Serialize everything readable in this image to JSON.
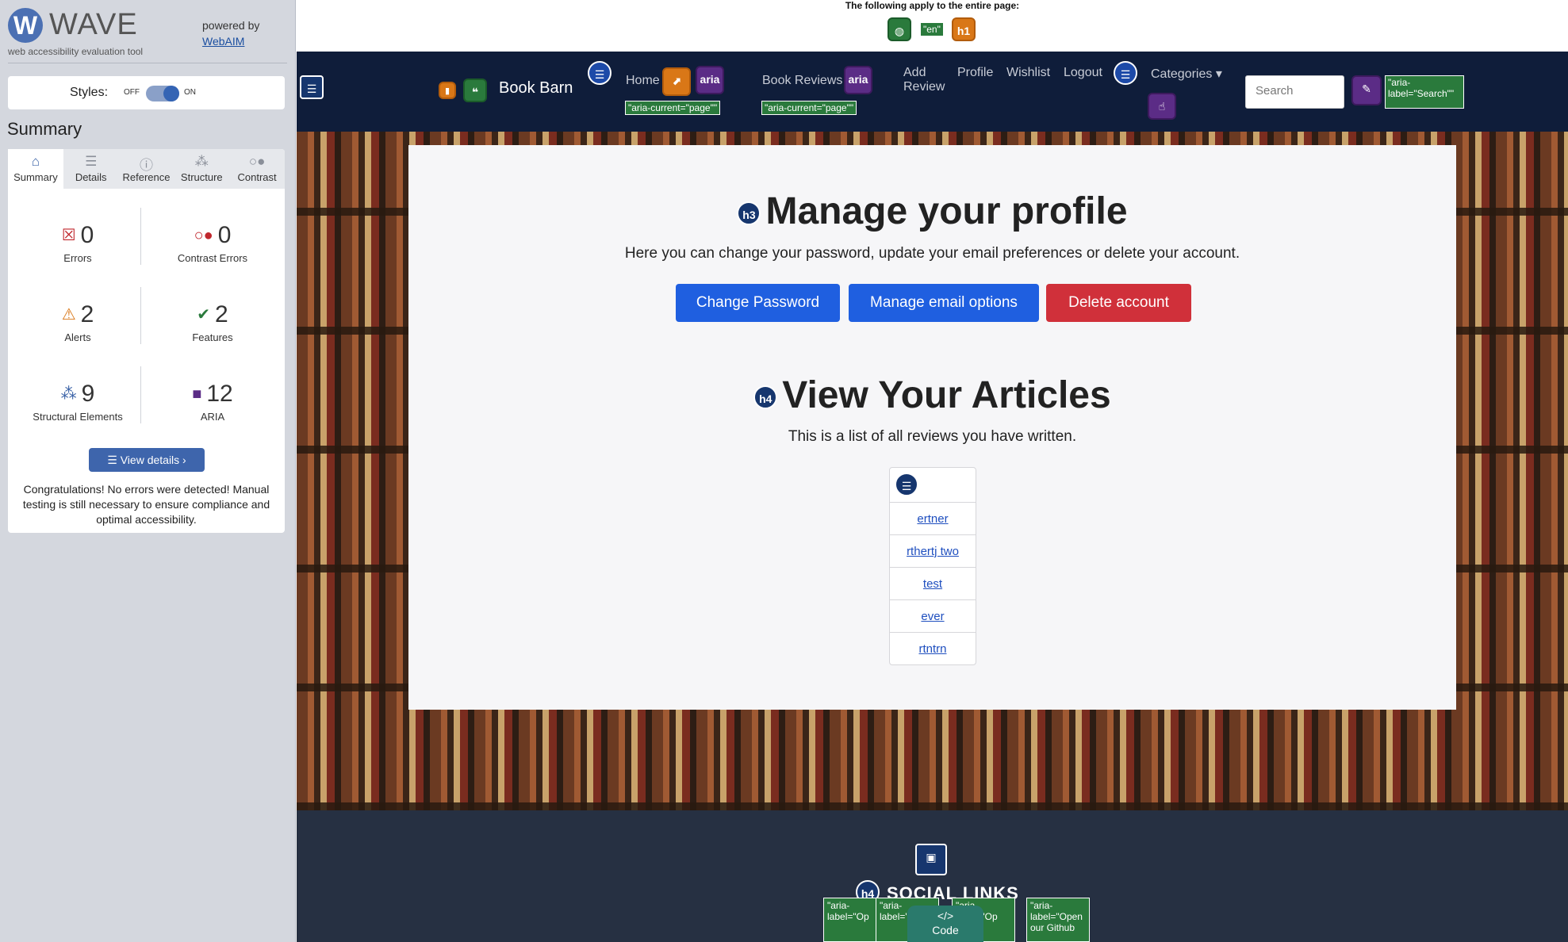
{
  "wave": {
    "logo_letter": "W",
    "name": "WAVE",
    "tagline": "web accessibility evaluation tool",
    "powered_by": "powered by",
    "webaim": "WebAIM",
    "styles_label": "Styles:",
    "styles_off": "OFF",
    "styles_on": "ON",
    "summary_title": "Summary",
    "tabs": [
      "Summary",
      "Details",
      "Reference",
      "Structure",
      "Contrast"
    ],
    "stats": {
      "errors": {
        "value": "0",
        "label": "Errors"
      },
      "contrast": {
        "value": "0",
        "label": "Contrast Errors"
      },
      "alerts": {
        "value": "2",
        "label": "Alerts"
      },
      "features": {
        "value": "2",
        "label": "Features"
      },
      "structural": {
        "value": "9",
        "label": "Structural Elements"
      },
      "aria": {
        "value": "12",
        "label": "ARIA"
      }
    },
    "view_details": "View details ›",
    "congrats": "Congratulations! No errors were detected! Manual testing is still necessary to ensure compliance and optimal accessibility."
  },
  "page_note": "The following apply to the entire page:",
  "wave_icons": {
    "lang": "\"en\"",
    "h1": "h1",
    "aria": "aria",
    "h3": "h3",
    "h4": "h4",
    "aria_current": "\"aria-current=\"page\"\"",
    "aria_label_search": "\"aria-label=\"Search\"\"",
    "code": "Code"
  },
  "nav": {
    "brand": "Book Barn",
    "home": "Home",
    "book_reviews": "Book Reviews",
    "add_review_line1": "Add",
    "add_review_line2": "Review",
    "profile": "Profile",
    "wishlist": "Wishlist",
    "logout": "Logout",
    "categories": "Categories",
    "search_placeholder": "Search"
  },
  "main": {
    "title": "Manage your profile",
    "subtitle": "Here you can change your password, update your email preferences or delete your account.",
    "buttons": {
      "change_password": "Change Password",
      "manage_email": "Manage email options",
      "delete_account": "Delete account"
    },
    "articles_title": "View Your Articles",
    "articles_subtitle": "This is a list of all reviews you have written.",
    "articles": [
      "ertner",
      "rthertj two",
      "test",
      "ever",
      "rtntrn"
    ]
  },
  "footer": {
    "title": "SOCIAL LINKS",
    "aria_labels": [
      "\"aria-label=\"Op",
      "\"aria-label=\"O",
      "\"aria-label=\"Op",
      "\"aria-label=\"Open our Github"
    ]
  },
  "colors": {
    "navbar": "#0f1d3a",
    "primary_button": "#1f5fe0",
    "danger_button": "#d0303a",
    "wave_accent": "#3e65ac"
  }
}
